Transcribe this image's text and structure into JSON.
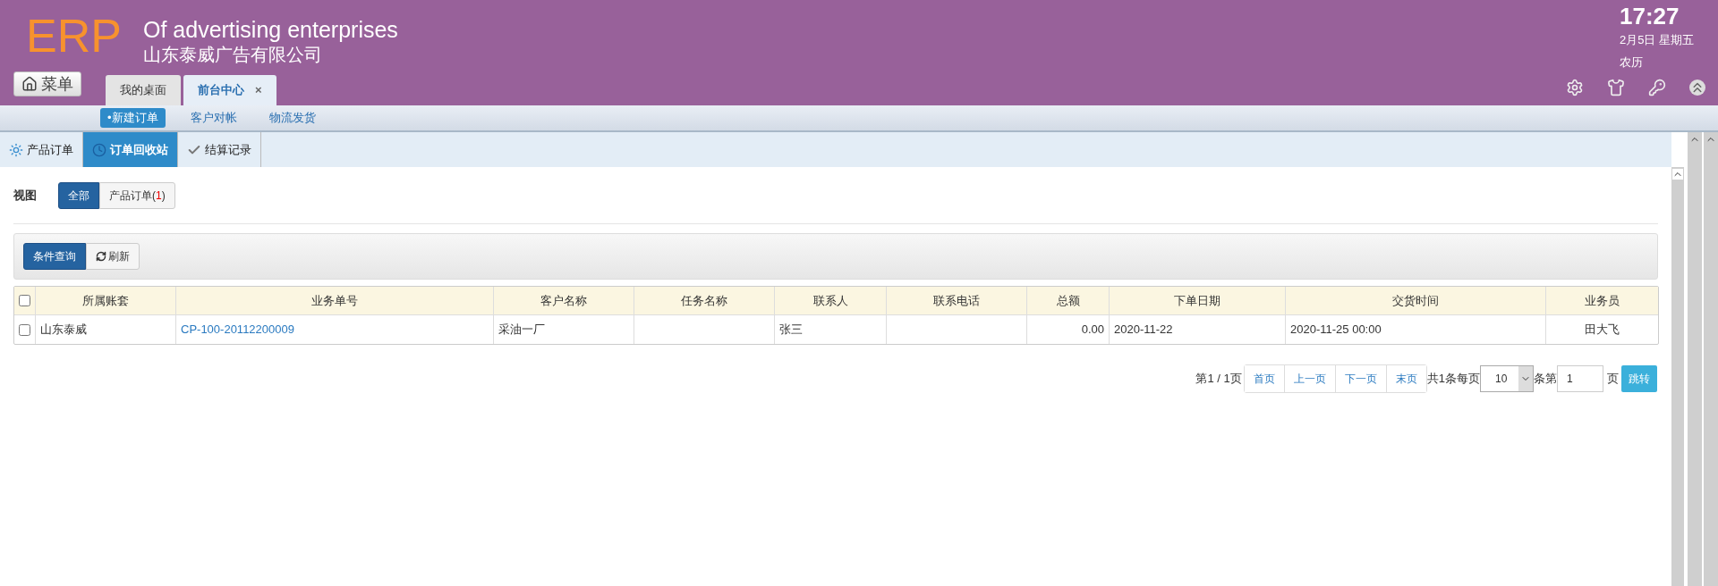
{
  "header": {
    "logo": "ERP",
    "title": "Of advertising enterprises",
    "company": "山东泰威广告有限公司",
    "time": "17:27",
    "date": "2月5日 星期五",
    "lunar": "农历"
  },
  "menu_button": {
    "label": "菜单"
  },
  "top_tabs": [
    {
      "label": "我的桌面",
      "selected": false
    },
    {
      "label": "前台中心",
      "selected": true,
      "close": "×"
    }
  ],
  "sub_nav": [
    {
      "label": "•新建订单",
      "selected": true
    },
    {
      "label": "客户对帐",
      "selected": false
    },
    {
      "label": "物流发货",
      "selected": false
    }
  ],
  "module_tabs": [
    {
      "label": "产品订单",
      "kind": "sun",
      "selected": false
    },
    {
      "label": "订单回收站",
      "kind": "clock",
      "selected": true
    },
    {
      "label": "结算记录",
      "kind": "check",
      "selected": false
    }
  ],
  "view": {
    "label": "视图",
    "options": [
      {
        "label": "全部",
        "selected": true
      },
      {
        "label": "产品订单(**1**)",
        "selected": false
      }
    ]
  },
  "toolbar": [
    {
      "label": "条件查询",
      "kind": "primary"
    },
    {
      "label": "刷新",
      "kind": "refresh"
    }
  ],
  "table": {
    "header_checked": false,
    "columns": [
      "所属账套",
      "业务单号",
      "客户名称",
      "任务名称",
      "联系人",
      "联系电话",
      "总额",
      "下单日期",
      "交货时间",
      "业务员"
    ],
    "rows": [
      {
        "checked": false,
        "cells": [
          "山东泰威",
          "CP-100-20112200009",
          "采油一厂",
          "",
          "张三",
          "",
          "0.00",
          "2020-11-22",
          "2020-11-25 00:00",
          "田大飞"
        ]
      }
    ]
  },
  "pagination": {
    "page_info": "第1 / 1页",
    "buttons": [
      "首页",
      "上一页",
      "下一页",
      "末页"
    ],
    "total": "共1条每页",
    "page_size": "10",
    "per": "条第",
    "page": "1",
    "page_suffix": "页",
    "go": "跳转"
  }
}
